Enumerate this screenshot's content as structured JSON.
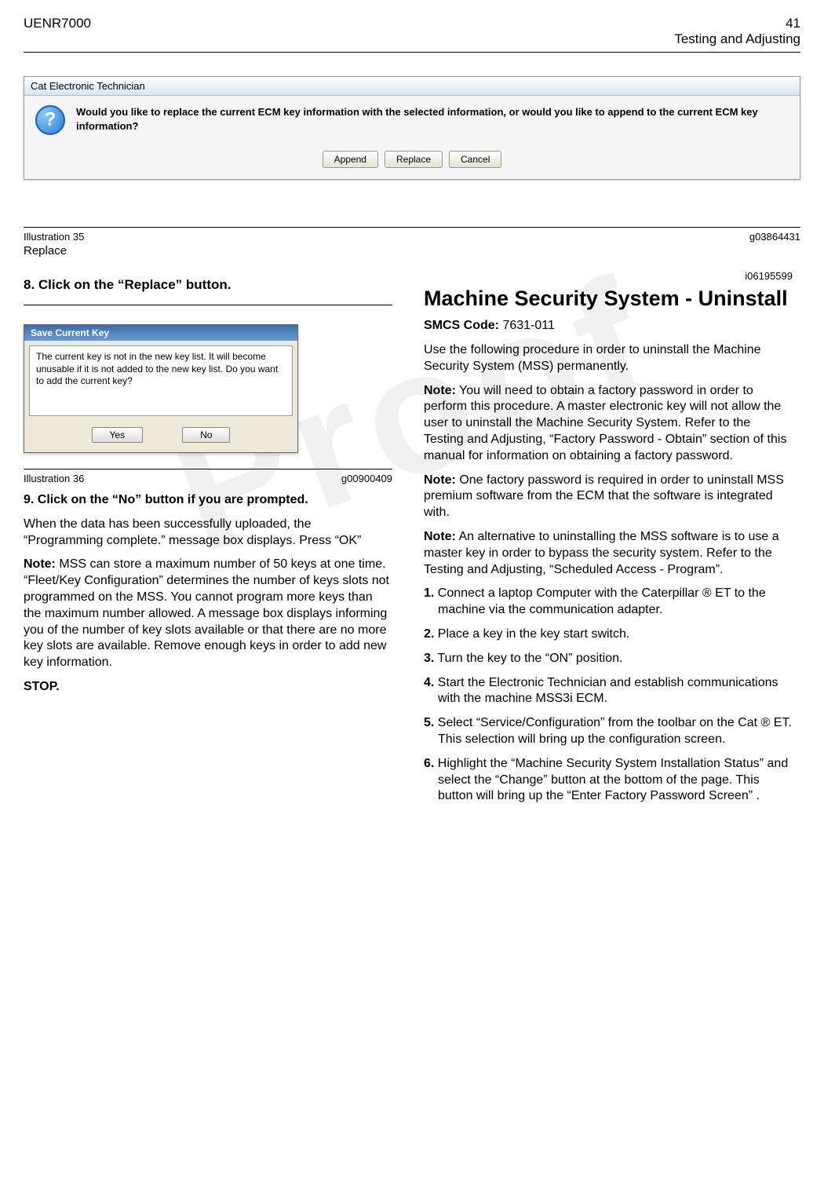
{
  "header": {
    "left": "UENR7000",
    "right_page": "41",
    "right_section": "Testing and Adjusting"
  },
  "dialog1": {
    "title": "Cat Electronic Technician",
    "message": "Would you like to replace the current ECM key information with the selected information, or would you like to append to the current ECM key information?",
    "append": "Append",
    "replace": "Replace",
    "cancel": "Cancel"
  },
  "caption1": {
    "left": "Illustration 35",
    "right": "g03864431",
    "label": "Replace"
  },
  "step8": "8. Click on the  “Replace”  button.",
  "dialog2": {
    "title": "Save Current Key",
    "body": "The current key is not in the new key list.  It will become unusable if it is not added to the new key list.  Do you want to add the current key?",
    "yes": "Yes",
    "no": "No"
  },
  "caption2": {
    "left": "Illustration 36",
    "right": "g00900409"
  },
  "left_col": {
    "step9": "9. Click on the  “No”  button if you are prompted.",
    "para1": "When the data has been successfully uploaded, the “Programming complete.”  message box displays. Press  “OK”",
    "note_label": "Note:",
    "note_body": " MSS can store a maximum number of 50 keys at one time.  “Fleet/Key Configuration”  determines the number of keys slots not programmed on the MSS. You cannot program more keys than the maximum number allowed. A message box displays informing you of the number of key slots available or that there are no more key slots are available. Remove enough keys in order to add new key information.",
    "stop": "STOP."
  },
  "right_col": {
    "id": "i06195599",
    "title": "Machine Security System - Uninstall",
    "smcs_label": "SMCS Code:",
    "smcs_value": "  7631-011",
    "para1": "Use the following procedure in order to uninstall the Machine Security System (MSS) permanently.",
    "note1_label": "Note:",
    "note1_body": " You will need to obtain a factory password in order to perform this procedure. A master electronic key will not allow the user to uninstall the Machine Security System. Refer to the Testing and Adjusting, “Factory Password - Obtain” section of this manual for information on obtaining a factory password.",
    "note2_label": "Note:",
    "note2_body": " One factory password is required in order to uninstall MSS premium software from the ECM that the software is integrated with.",
    "note3_label": "Note:",
    "note3_body": " An alternative to uninstalling the MSS software is to use a master key in order to bypass the security system. Refer to the Testing and Adjusting, “Scheduled Access - Program”.",
    "steps": {
      "s1_num": "1.",
      "s1": " Connect a laptop Computer with the Caterpillar ® ET to the machine via the communication adapter.",
      "s2_num": "2.",
      "s2": " Place a key in the key start switch.",
      "s3_num": "3.",
      "s3": " Turn the key to the  “ON”  position.",
      "s4_num": "4.",
      "s4": " Start the Electronic Technician and establish communications with the machine MSS3i ECM.",
      "s5_num": "5.",
      "s5": " Select  “Service/Configuration”  from the toolbar on the Cat ® ET. This selection will bring up the configuration screen.",
      "s6_num": "6.",
      "s6": " Highlight the  “Machine Security System Installation Status”  and select the  “Change”  button at the bottom of the page. This button will bring up the  “Enter Factory Password Screen” ."
    }
  }
}
